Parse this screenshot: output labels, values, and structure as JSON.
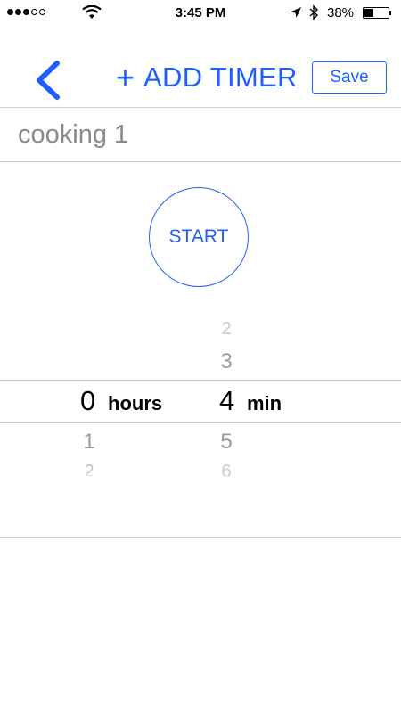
{
  "status_bar": {
    "signal_bars_filled": 3,
    "signal_bars_total": 5,
    "time": "3:45 PM",
    "battery_percent_label": "38%",
    "battery_level": 0.38,
    "icons": [
      "signal-dots",
      "wifi-icon",
      "location-arrow-icon",
      "bluetooth-icon",
      "battery-icon"
    ]
  },
  "nav": {
    "back_icon": "chevron-left-icon",
    "add_timer_plus": "+",
    "add_timer_label": "ADD TIMER",
    "save_label": "Save"
  },
  "timer": {
    "name_value": "cooking 1",
    "start_label": "START"
  },
  "picker": {
    "hours": {
      "above": [
        "",
        ""
      ],
      "selected": "0",
      "unit": "hours",
      "below": [
        "1",
        "2"
      ]
    },
    "minutes": {
      "above": [
        "2",
        "3"
      ],
      "selected": "4",
      "unit": "min",
      "below": [
        "5",
        "6"
      ]
    }
  },
  "colors": {
    "accent": "#1f5fff",
    "divider": "#cfcfcf",
    "placeholder_text": "#8a8a8a",
    "picker_faded": "#9a9a9a"
  }
}
